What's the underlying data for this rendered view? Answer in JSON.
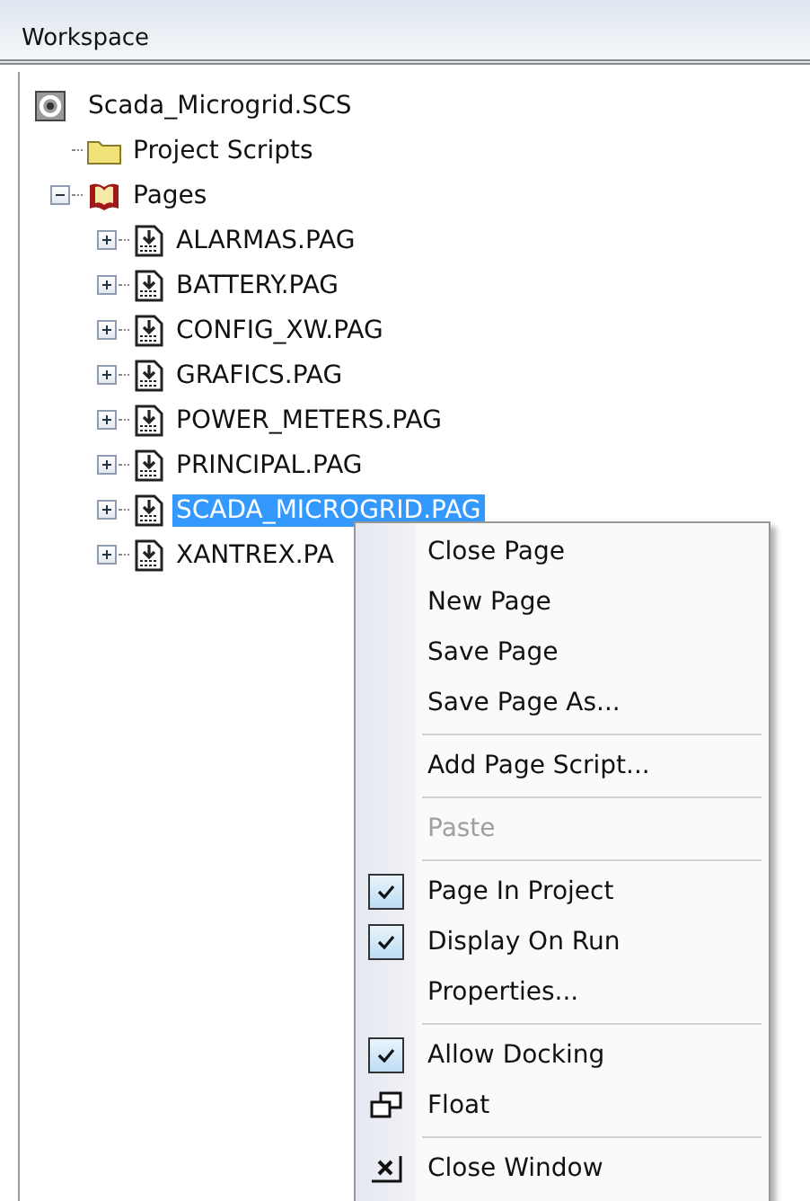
{
  "panel": {
    "title": "Workspace"
  },
  "tree": {
    "label": "Scada_Microgrid.SCS",
    "children": [
      {
        "label": "Project Scripts"
      },
      {
        "label": "Pages",
        "expanded": true,
        "children": [
          {
            "label": "ALARMAS.PAG",
            "selected": false
          },
          {
            "label": "BATTERY.PAG",
            "selected": false
          },
          {
            "label": "CONFIG_XW.PAG",
            "selected": false
          },
          {
            "label": "GRAFICS.PAG",
            "selected": false
          },
          {
            "label": "POWER_METERS.PAG",
            "selected": false
          },
          {
            "label": "PRINCIPAL.PAG",
            "selected": false
          },
          {
            "label": "SCADA_MICROGRID.PAG",
            "selected": true
          },
          {
            "label": "XANTREX.PA",
            "selected": false
          }
        ]
      }
    ]
  },
  "menu": {
    "items": [
      {
        "kind": "item",
        "label": "Close Page",
        "disabled": false,
        "checked": false
      },
      {
        "kind": "item",
        "label": "New Page",
        "disabled": false,
        "checked": false
      },
      {
        "kind": "item",
        "label": "Save Page",
        "disabled": false,
        "checked": false
      },
      {
        "kind": "item",
        "label": "Save Page As...",
        "disabled": false,
        "checked": false
      },
      {
        "kind": "separator"
      },
      {
        "kind": "item",
        "label": "Add Page Script...",
        "disabled": false,
        "checked": false
      },
      {
        "kind": "separator"
      },
      {
        "kind": "item",
        "label": "Paste",
        "disabled": true,
        "checked": false
      },
      {
        "kind": "separator"
      },
      {
        "kind": "item",
        "label": "Page In Project",
        "disabled": false,
        "checked": true
      },
      {
        "kind": "item",
        "label": "Display On Run",
        "disabled": false,
        "checked": true
      },
      {
        "kind": "item",
        "label": "Properties...",
        "disabled": false,
        "checked": false
      },
      {
        "kind": "separator"
      },
      {
        "kind": "item",
        "label": "Allow Docking",
        "disabled": false,
        "checked": true
      },
      {
        "kind": "float",
        "label": "Float"
      },
      {
        "kind": "separator"
      },
      {
        "kind": "close",
        "label": "Close Window"
      }
    ]
  }
}
